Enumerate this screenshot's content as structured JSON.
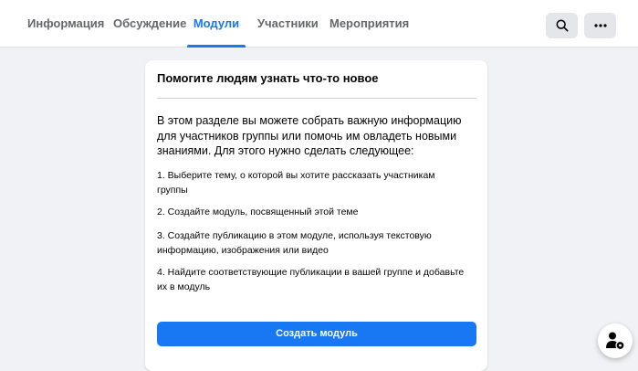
{
  "tabs": [
    {
      "label": "Информация",
      "active": false
    },
    {
      "label": "Обсуждение",
      "active": false
    },
    {
      "label": "Модули",
      "active": true
    },
    {
      "label": "Участники",
      "active": false
    },
    {
      "label": "Мероприятия",
      "active": false
    }
  ],
  "header_icons": {
    "search": "search-icon",
    "more": "more-icon"
  },
  "card": {
    "title": "Помогите людям узнать что-то новое",
    "intro": "В этом разделе вы можете собрать важную информацию для участников группы или помочь им овладеть новыми знаниями. Для этого нужно сделать следующее:",
    "steps": [
      "1. Выберите тему, о которой вы хотите рассказать участникам группы",
      "2. Создайте модуль, посвященный этой теме",
      "3. Создайте публикацию в этом модуле, используя текстовую информацию, изображения или видео",
      "4. Найдите соответствующие публикации в вашей группе и добавьте их в модуль"
    ],
    "button_label": "Создать модуль"
  },
  "fab_icon": "members-icon",
  "colors": {
    "accent": "#1877f2",
    "background": "#f0f2f5",
    "text": "#050505",
    "muted": "#65676b",
    "icon_button": "#e4e6eb"
  }
}
